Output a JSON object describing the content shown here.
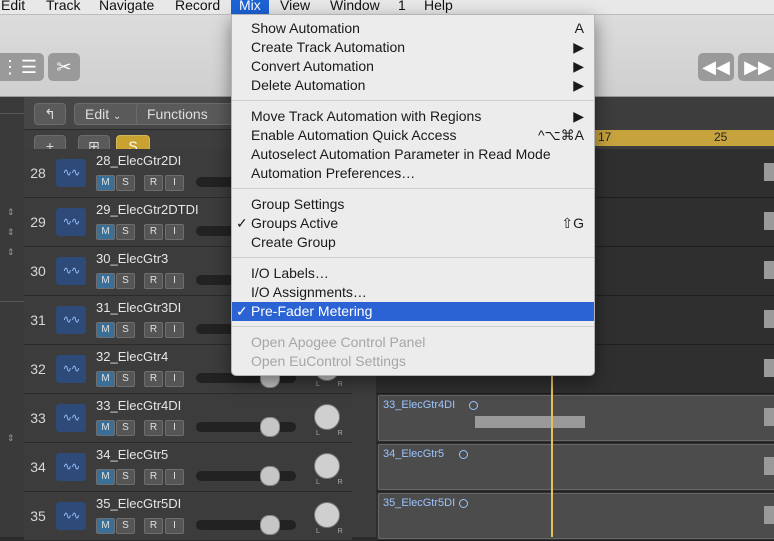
{
  "menubar": [
    "Edit",
    "Track",
    "Navigate",
    "Record",
    "Mix",
    "View",
    "Window",
    "1",
    "Help"
  ],
  "menubar_active": "Mix",
  "local_bar": {
    "edit": "Edit",
    "functions": "Functions",
    "s_button": "S"
  },
  "tracks": [
    {
      "num": "28",
      "name": "28_ElecGtr2DI",
      "show_region": false
    },
    {
      "num": "29",
      "name": "29_ElecGtr2DTDI",
      "show_region": false
    },
    {
      "num": "30",
      "name": "30_ElecGtr3",
      "show_region": false
    },
    {
      "num": "31",
      "name": "31_ElecGtr3DI",
      "show_region": false
    },
    {
      "num": "32",
      "name": "32_ElecGtr4",
      "show_region": false
    },
    {
      "num": "33",
      "name": "33_ElecGtr4DI",
      "show_region": true
    },
    {
      "num": "34",
      "name": "34_ElecGtr5",
      "show_region": true
    },
    {
      "num": "35",
      "name": "35_ElecGtr5DI",
      "show_region": true
    }
  ],
  "track_buttons": [
    "M",
    "S",
    "R",
    "I"
  ],
  "ruler": {
    "bar1": "17",
    "bar2": "25"
  },
  "mix_menu": [
    {
      "label": "Show Automation",
      "shortcut": "A",
      "type": "item"
    },
    {
      "label": "Create Track Automation",
      "shortcut": "▶",
      "type": "item"
    },
    {
      "label": "Convert Automation",
      "shortcut": "▶",
      "type": "item"
    },
    {
      "label": "Delete Automation",
      "shortcut": "▶",
      "type": "item"
    },
    {
      "type": "separator"
    },
    {
      "label": "Move Track Automation with Regions",
      "shortcut": "▶",
      "type": "item"
    },
    {
      "label": "Enable Automation Quick Access",
      "shortcut": "^⌥⌘A",
      "type": "item"
    },
    {
      "label": "Autoselect Automation Parameter in Read Mode",
      "shortcut": "",
      "type": "item"
    },
    {
      "label": "Automation Preferences…",
      "shortcut": "",
      "type": "item"
    },
    {
      "type": "separator"
    },
    {
      "label": "Group Settings",
      "shortcut": "",
      "type": "item"
    },
    {
      "label": "Groups Active",
      "shortcut": "⇧G",
      "type": "item",
      "checked": true
    },
    {
      "label": "Create Group",
      "shortcut": "",
      "type": "item"
    },
    {
      "type": "separator"
    },
    {
      "label": "I/O Labels…",
      "shortcut": "",
      "type": "item"
    },
    {
      "label": "I/O Assignments…",
      "shortcut": "",
      "type": "item"
    },
    {
      "label": "Pre-Fader Metering",
      "shortcut": "",
      "type": "item",
      "checked": true,
      "selected": true
    },
    {
      "type": "separator"
    },
    {
      "label": "Open Apogee Control Panel",
      "shortcut": "",
      "type": "item",
      "disabled": true
    },
    {
      "label": "Open EuControl Settings",
      "shortcut": "",
      "type": "item",
      "disabled": true
    }
  ],
  "colors": {
    "menu_highlight": "#2b63d4",
    "ruler": "#c7a33e",
    "mute_active": "#3a6f97",
    "region_label": "#9cc4ff"
  }
}
